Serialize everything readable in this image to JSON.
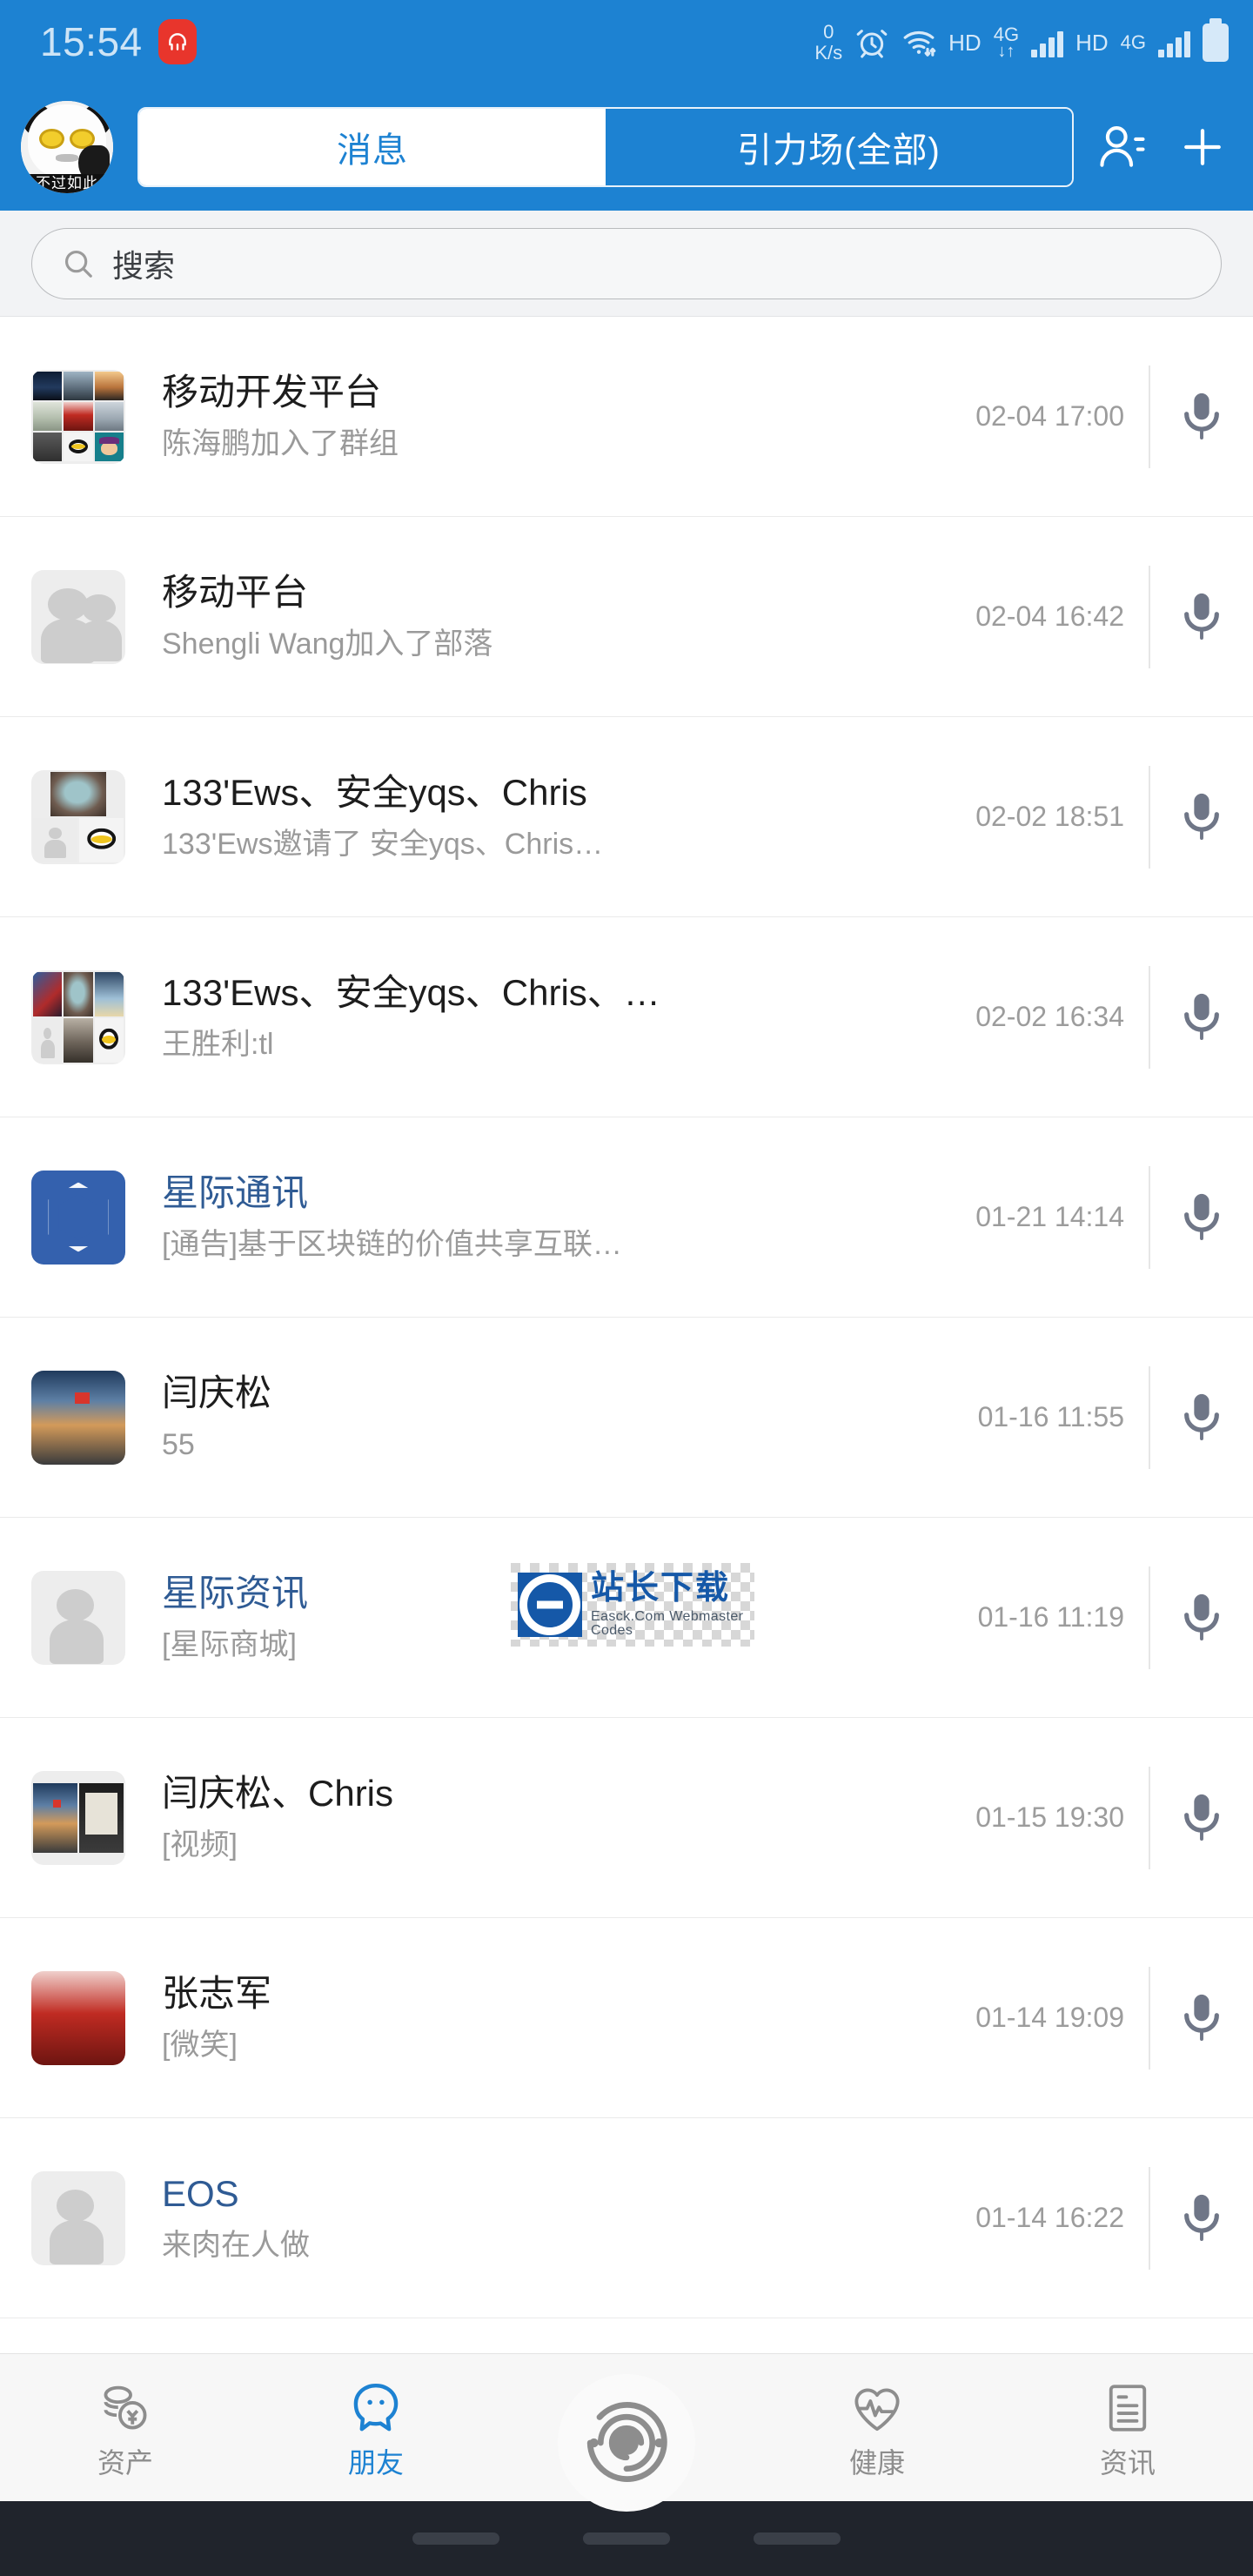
{
  "status_bar": {
    "time": "15:54",
    "headphone_badge_color": "#e8352c",
    "network_speed_value": "0",
    "network_speed_unit": "K/s",
    "hd_label_1": "HD",
    "lte_label_1": "4G",
    "hd_label_2": "HD",
    "lte_label_2": "4G",
    "icons": [
      "alarm-icon",
      "wifi-icon",
      "signal-icon",
      "battery-icon"
    ]
  },
  "header": {
    "profile_avatar_caption": "不过如此",
    "tabs": [
      {
        "label": "消息",
        "active": true
      },
      {
        "label": "引力场(全部)",
        "active": false
      }
    ],
    "add_contact_icon": "person-add-icon",
    "plus_icon": "plus-icon",
    "background_color": "#1d82d2"
  },
  "search": {
    "placeholder": "搜索",
    "icon": "search-icon"
  },
  "chats": [
    {
      "title": "移动开发平台",
      "subtitle": "陈海鹏加入了群组",
      "time": "02-04 17:00",
      "title_color": "dark",
      "avatar": "grid-3x3",
      "action_icon": "microphone-icon"
    },
    {
      "title": "移动平台",
      "subtitle": "Shengli Wang加入了部落",
      "time": "02-04 16:42",
      "title_color": "dark",
      "avatar": "default-group",
      "action_icon": "microphone-icon"
    },
    {
      "title": "133'Ews、安全yqs、Chris",
      "subtitle": "133'Ews邀请了 安全yqs、Chris…",
      "time": "02-02 18:51",
      "title_color": "dark",
      "avatar": "grid-3",
      "action_icon": "microphone-icon"
    },
    {
      "title": "133'Ews、安全yqs、Chris、…",
      "subtitle": "王胜利:tl",
      "time": "02-02 16:34",
      "title_color": "dark",
      "avatar": "grid-3x2",
      "action_icon": "microphone-icon"
    },
    {
      "title": "星际通讯",
      "subtitle": "[通告]基于区块链的价值共享互联…",
      "time": "01-21 14:14",
      "title_color": "blue",
      "avatar": "hexagon-logo",
      "action_icon": "microphone-icon"
    },
    {
      "title": "闫庆松",
      "subtitle": "55",
      "time": "01-16 11:55",
      "title_color": "dark",
      "avatar": "photo-flag",
      "action_icon": "microphone-icon"
    },
    {
      "title": "星际资讯",
      "subtitle": "[星际商城]",
      "time": "01-16 11:19",
      "title_color": "blue",
      "avatar": "default-person",
      "action_icon": "microphone-icon"
    },
    {
      "title": "闫庆松、Chris",
      "subtitle": "[视频]",
      "time": "01-15 19:30",
      "title_color": "dark",
      "avatar": "grid-2",
      "action_icon": "microphone-icon"
    },
    {
      "title": "张志军",
      "subtitle": "[微笑]",
      "time": "01-14 19:09",
      "title_color": "dark",
      "avatar": "photo-car",
      "action_icon": "microphone-icon"
    },
    {
      "title": "EOS",
      "subtitle": "来肉在人做",
      "time": "01-14 16:22",
      "title_color": "blue",
      "avatar": "default-person",
      "action_icon": "microphone-icon"
    }
  ],
  "watermark": {
    "main_text": "站长下载",
    "sub_text": "Easck.Com Webmaster Codes"
  },
  "bottom_nav": {
    "items": [
      {
        "label": "资产",
        "icon": "coins-icon",
        "active": false
      },
      {
        "label": "朋友",
        "icon": "chat-bubble-icon",
        "active": true
      },
      {
        "label": "",
        "icon": "spiral-icon",
        "active": false
      },
      {
        "label": "健康",
        "icon": "heart-pulse-icon",
        "active": false
      },
      {
        "label": "资讯",
        "icon": "document-icon",
        "active": false
      }
    ],
    "active_color": "#1d82d2",
    "inactive_color": "#8d8d8d"
  }
}
